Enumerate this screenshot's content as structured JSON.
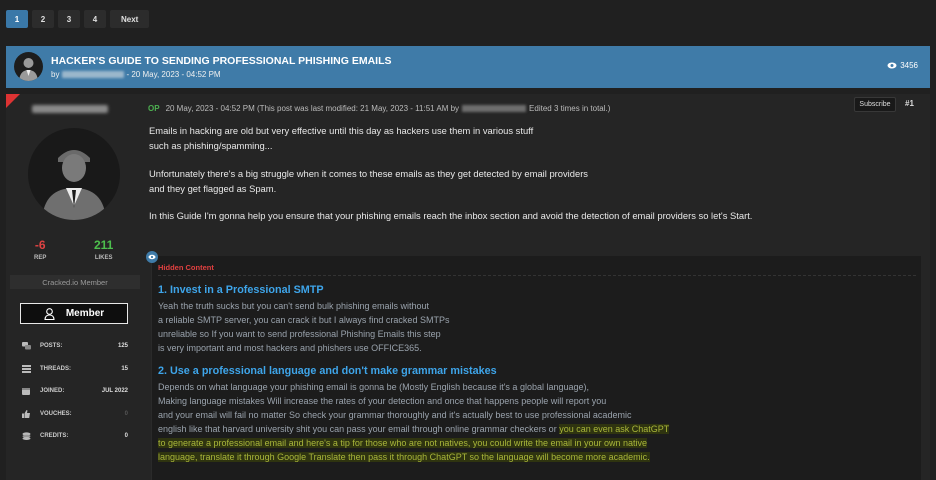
{
  "pagination": {
    "pages": [
      "1",
      "2",
      "3",
      "4"
    ],
    "next_label": "Next",
    "active": "1"
  },
  "thread": {
    "title": "HACKER'S GUIDE TO SENDING PROFESSIONAL PHISHING EMAILS",
    "by_label": "by",
    "date": "- 20 May, 2023 - 04:52 PM",
    "views": "3456"
  },
  "user": {
    "rep_value": "-6",
    "rep_label": "REP",
    "likes_value": "211",
    "likes_label": "LIKES",
    "usergroup": "Cracked.io Member",
    "badge": "Member",
    "stats": [
      {
        "icon": "chat-icon",
        "label": "POSTS:",
        "value": "125"
      },
      {
        "icon": "threads-icon",
        "label": "THREADS:",
        "value": "15"
      },
      {
        "icon": "calendar-icon",
        "label": "JOINED:",
        "value": "JUL 2022"
      },
      {
        "icon": "thumbs-up-icon",
        "label": "VOUCHES:",
        "value": "0"
      },
      {
        "icon": "credits-icon",
        "label": "CREDITS:",
        "value": "0"
      }
    ]
  },
  "post": {
    "op_tag": "OP",
    "meta_before": "20 May, 2023 - 04:52 PM (This post was last modified: 21 May, 2023 - 11:51 AM by",
    "meta_after": "Edited 3 times in total.)",
    "subscribe_label": "Subscribe",
    "post_number": "#1",
    "intro": [
      "Emails in hacking are old but very effective until this day as hackers use them in various stuff",
      "such as phishing/spamming...",
      "Unfortunately there's a big struggle when it comes to these emails as they get detected by email providers",
      "and they get flagged as Spam.",
      "In this Guide I'm gonna help you ensure that your phishing emails reach the inbox section and avoid the detection of email providers so let's Start."
    ],
    "hidden_label": "Hidden Content",
    "sections": [
      {
        "heading": "1. Invest in a Professional SMTP",
        "lines": [
          "Yeah the truth sucks but you can't send bulk phishing emails without",
          "a reliable SMTP server, you can crack it but I always find cracked SMTPs",
          "unreliable so If you want to send professional Phishing Emails this step",
          "is very important and most hackers and phishers use OFFICE365."
        ]
      },
      {
        "heading": "2. Use a professional language and don't make grammar mistakes",
        "lines": [
          "Depends on what language your phishing email is gonna be (Mostly English because it's a global language),",
          "Making language mistakes Will increase the rates of your detection and once that happens people will report you",
          "and your email will fail no matter So check your grammar thoroughly and it's actually best to use professional academic"
        ],
        "mixed_line_plain": "english like that harvard university shit you can pass your email through online grammar checkers or ",
        "mixed_line_green": "you can even ask ChatGPT",
        "green_lines": [
          "to generate a professional email and here's a tip for those who are not natives, you could write the email in your own native",
          "language, translate it through Google Translate then pass it through ChatGPT so the language will become more academic."
        ]
      }
    ]
  }
}
